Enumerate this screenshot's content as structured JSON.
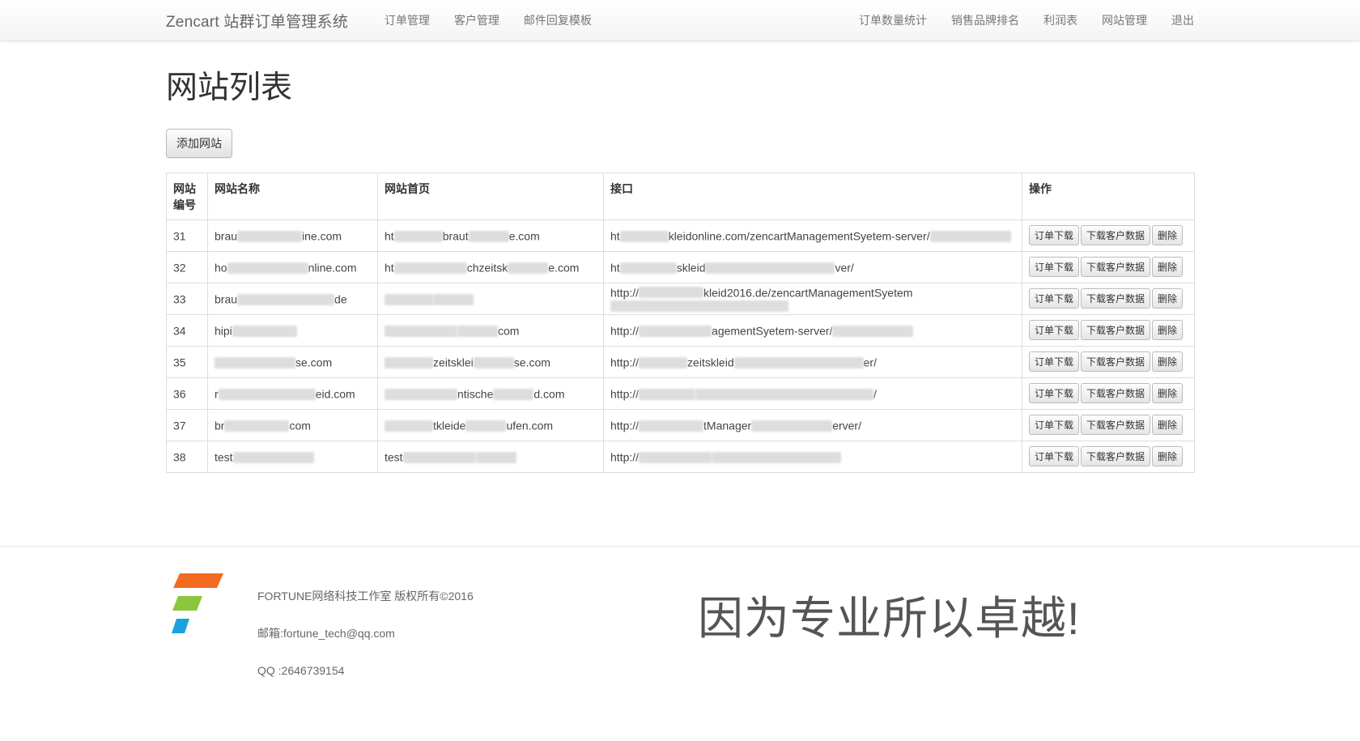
{
  "navbar": {
    "brand": "Zencart 站群订单管理系统",
    "left_links": [
      "订单管理",
      "客户管理",
      "邮件回复模板"
    ],
    "right_links": [
      "订单数量统计",
      "销售品牌排名",
      "利润表",
      "网站管理",
      "退出"
    ]
  },
  "page": {
    "title": "网站列表",
    "add_button": "添加网站"
  },
  "table": {
    "headers": {
      "id": "网站编号",
      "name": "网站名称",
      "home": "网站首页",
      "api": "接口",
      "ops": "操作"
    },
    "actions": {
      "download_orders": "订单下载",
      "download_customers": "下载客户数据",
      "delete": "删除"
    },
    "rows": [
      {
        "id": "31",
        "name": "brau",
        "name_tail": "ine.com",
        "home": "ht",
        "home_mid": "braut",
        "home_tail": "e.com",
        "api": "ht",
        "api_mid": "kleidonline.com/zencartManagementSyetem-server/",
        "api_tail": ""
      },
      {
        "id": "32",
        "name": "ho",
        "name_tail": "nline.com",
        "home": "ht",
        "home_mid": "chzeitsk",
        "home_tail": "e.com",
        "api": "ht",
        "api_mid": "skleid",
        "api_tail": "ver/"
      },
      {
        "id": "33",
        "name": "brau",
        "name_tail": "de",
        "home": "",
        "home_mid": "",
        "home_tail": "",
        "api": "http://",
        "api_mid": "kleid2016.de/zencartManagementSyetem",
        "api_tail": ""
      },
      {
        "id": "34",
        "name": "hipi",
        "name_tail": "",
        "home": "",
        "home_mid": "",
        "home_tail": "com",
        "api": "http://",
        "api_mid": "agementSyetem-server/",
        "api_tail": ""
      },
      {
        "id": "35",
        "name": "",
        "name_tail": "se.com",
        "home": "",
        "home_mid": "zeitsklei",
        "home_tail": "se.com",
        "api": "http://",
        "api_mid": "zeitskleid",
        "api_tail": "er/"
      },
      {
        "id": "36",
        "name": "r",
        "name_tail": "eid.com",
        "home": "",
        "home_mid": "ntische",
        "home_tail": "d.com",
        "api": "http://",
        "api_mid": "",
        "api_tail": "/"
      },
      {
        "id": "37",
        "name": "br",
        "name_tail": "com",
        "home": "",
        "home_mid": "tkleide",
        "home_tail": "ufen.com",
        "api": "http://",
        "api_mid": "tManager",
        "api_tail": "erver/"
      },
      {
        "id": "38",
        "name": "test",
        "name_tail": "",
        "home": "test",
        "home_mid": "",
        "home_tail": "",
        "api": "http://",
        "api_mid": "",
        "api_tail": ""
      }
    ]
  },
  "footer": {
    "copyright": "FORTUNE网络科技工作室 版权所有©2016",
    "email": "邮箱:fortune_tech@qq.com",
    "qq": "QQ  :2646739154",
    "slogan": "因为专业所以卓越!",
    "logo_colors": [
      "#f26b21",
      "#8cc63f",
      "#1ba1e2"
    ]
  }
}
